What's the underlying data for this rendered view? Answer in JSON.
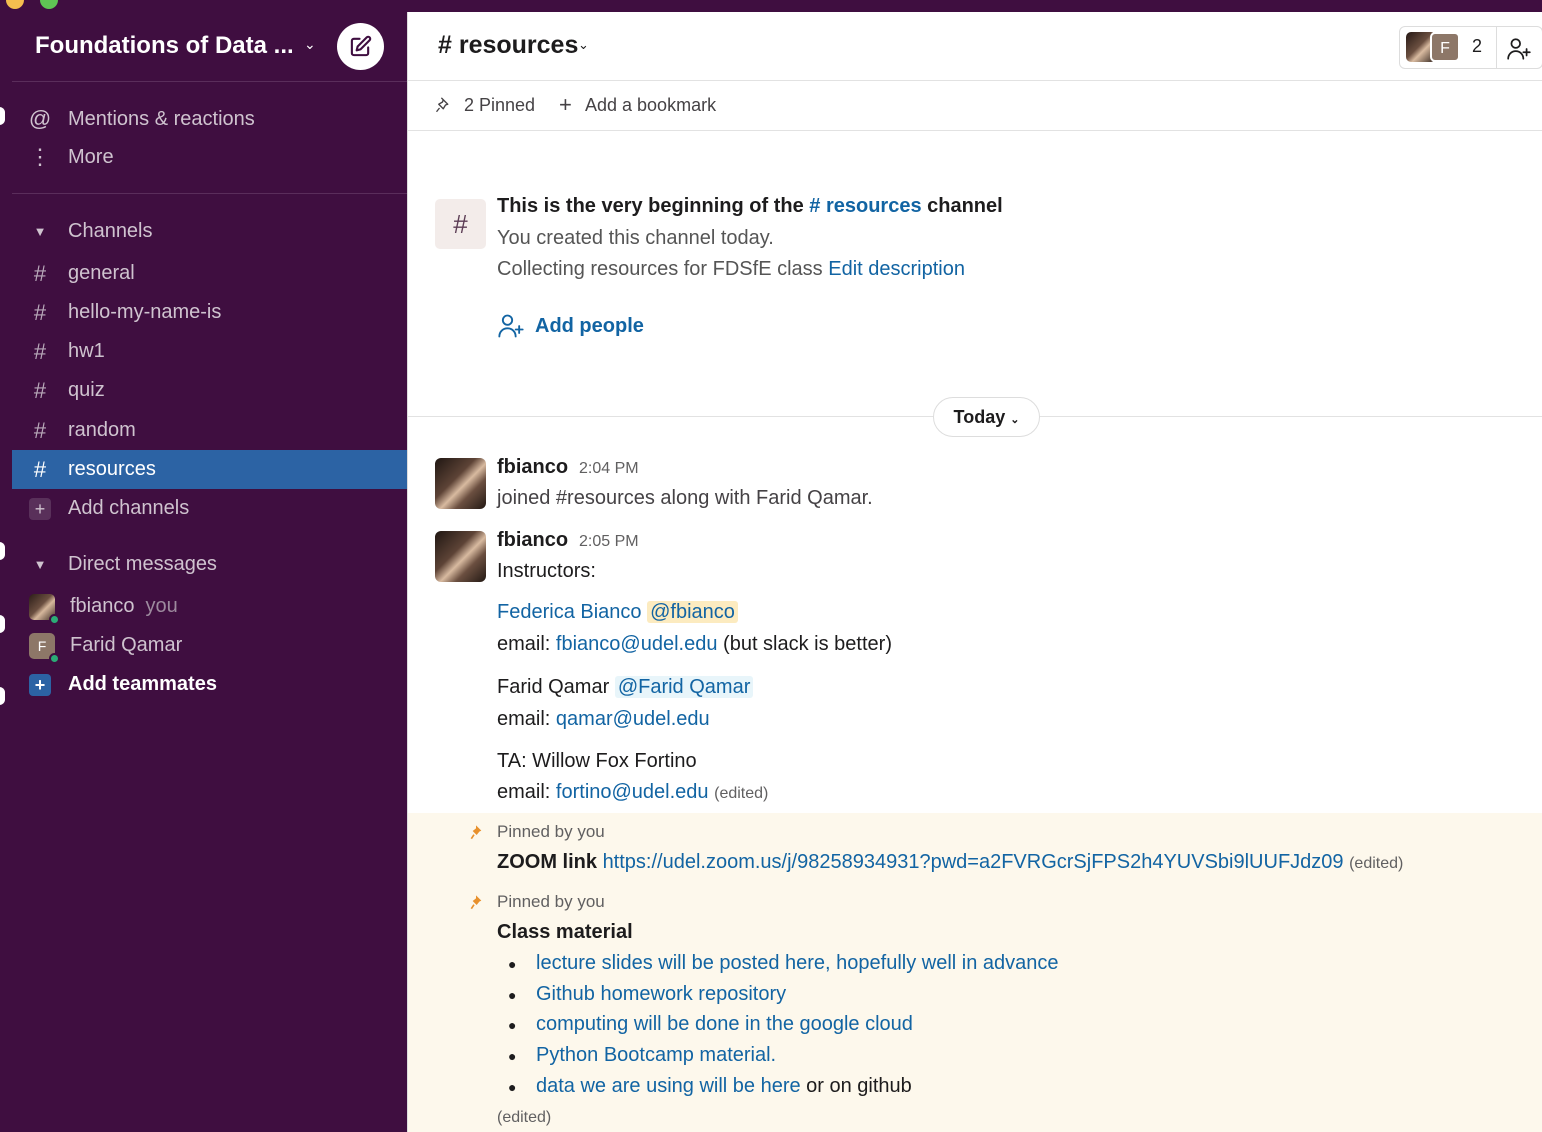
{
  "sidebar": {
    "workspace_name": "Foundations of Data ...",
    "nav": [
      {
        "icon": "at-icon",
        "label": "Mentions & reactions"
      },
      {
        "icon": "more-icon",
        "label": "More"
      }
    ],
    "channels_header": "Channels",
    "channels": [
      "general",
      "hello-my-name-is",
      "hw1",
      "quiz",
      "random",
      "resources"
    ],
    "active_channel": "resources",
    "add_channels": "Add channels",
    "dm_header": "Direct messages",
    "dms": [
      {
        "name": "fbianco",
        "suffix": "you"
      },
      {
        "name": "Farid Qamar",
        "initial": "F"
      }
    ],
    "add_teammates": "Add teammates"
  },
  "header": {
    "channel_title": "# resources",
    "member_initial": "F",
    "member_count": "2",
    "pinned": "2 Pinned",
    "add_bookmark": "Add a bookmark"
  },
  "intro": {
    "title_pre": "This is the very beginning of the",
    "title_channel": "# resources",
    "title_post": "channel",
    "created": "You created this channel today.",
    "description": "Collecting resources for FDSfE class",
    "edit_description": "Edit description",
    "add_people": "Add people"
  },
  "day_divider": "Today",
  "messages": [
    {
      "author": "fbianco",
      "time": "2:04 PM",
      "text": "joined #resources along with Farid Qamar."
    },
    {
      "author": "fbianco",
      "time": "2:05 PM",
      "heading": "Instructors:",
      "inst1_name": "Federica Bianco",
      "inst1_mention": "@fbianco",
      "inst1_email_label": "email:",
      "inst1_email": "fbianco@udel.edu",
      "inst1_note": "(but slack is better)",
      "inst2_name": "Farid Qamar",
      "inst2_mention": "@Farid Qamar",
      "inst2_email_label": "email:",
      "inst2_email": "qamar@udel.edu",
      "ta": "TA: Willow Fox Fortino",
      "ta_email_label": "email:",
      "ta_email": "fortino@udel.edu",
      "edited": "(edited)"
    }
  ],
  "pinned": [
    {
      "label": "Pinned by you",
      "bold": "ZOOM link",
      "link": "https://udel.zoom.us/j/98258934931?pwd=a2FVRGcrSjFPS2h4YUVSbi9lUUFJdz09",
      "edited": "(edited)"
    },
    {
      "label": "Pinned by you",
      "bold": "Class material",
      "items": [
        {
          "link": "lecture slides will be posted here, hopefully well in advance",
          "rest": ""
        },
        {
          "link": "Github homework repository",
          "rest": ""
        },
        {
          "link": "computing will be done in the google cloud",
          "rest": ""
        },
        {
          "link": "Python Bootcamp material.",
          "rest": ""
        },
        {
          "link": "data we are using will be here",
          "rest": " or on github"
        }
      ],
      "edited": "(edited)"
    }
  ],
  "colors": {
    "sidebar_bg": "#3f0e40",
    "active": "#2c63a4",
    "link": "#1264a3",
    "pinned_bg": "#fdf8ec"
  }
}
